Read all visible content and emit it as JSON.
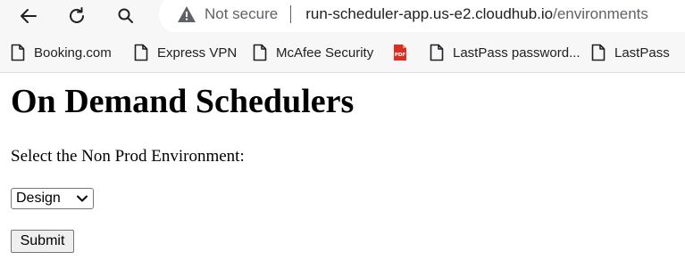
{
  "browser": {
    "nav": {
      "back_icon": "arrow-left-icon",
      "reload_icon": "reload-icon",
      "search_icon": "search-icon"
    },
    "omnibox": {
      "security_icon": "warning-triangle-icon",
      "security_label": "Not secure",
      "url_host": "run-scheduler-app.us-e2.cloudhub.io",
      "url_path": "/environments"
    },
    "bookmarks": [
      {
        "label": "Booking.com",
        "icon": "page-icon"
      },
      {
        "label": "Express VPN",
        "icon": "page-icon"
      },
      {
        "label": "McAfee Security",
        "icon": "page-icon"
      },
      {
        "label": "LastPass password...",
        "icon": "pdf-icon",
        "icon2": "page-icon"
      },
      {
        "label": "LastPass",
        "icon": "page-icon"
      }
    ]
  },
  "page": {
    "title": "On Demand Schedulers",
    "prompt": "Select the Non Prod Environment:",
    "environment_select": {
      "selected": "Design"
    },
    "submit_label": "Submit"
  },
  "colors": {
    "chrome_bg": "#f7f7f7",
    "omnibox_bg": "#ffffff",
    "muted_text": "#5f6368",
    "pdf_red": "#d93025"
  }
}
